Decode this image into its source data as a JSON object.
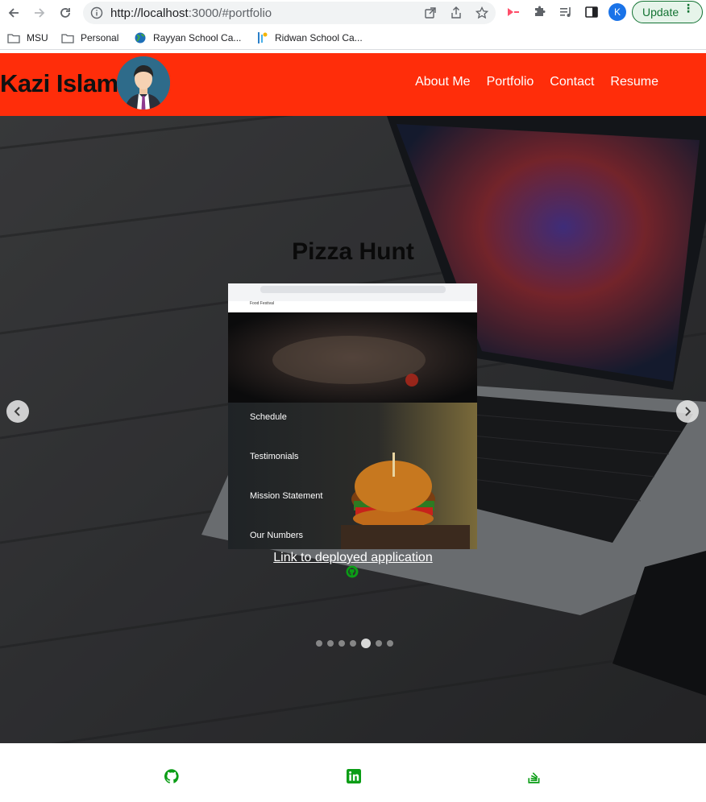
{
  "browser": {
    "url_host": "http://localhost",
    "url_rest": ":3000/#portfolio",
    "profile_initial": "K",
    "update_label": "Update",
    "update_more": "⋮"
  },
  "bookmarks": [
    {
      "label": "MSU",
      "icon": "folder-icon"
    },
    {
      "label": "Personal",
      "icon": "folder-icon"
    },
    {
      "label": "Rayyan School Ca...",
      "icon": "globe-icon"
    },
    {
      "label": "Ridwan School Ca...",
      "icon": "site-favicon-icon"
    }
  ],
  "header": {
    "brand": "Kazi Islam",
    "nav": [
      "About Me",
      "Portfolio",
      "Contact",
      "Resume"
    ],
    "brand_color": "#ff2d0a"
  },
  "carousel": {
    "slide_title": "Pizza Hunt",
    "screenshot_sections": [
      "Schedule",
      "Testimonials",
      "Mission Statement",
      "Our Numbers"
    ],
    "screenshot_brand": "Food Festival",
    "link_text": "Link to deployed application",
    "slide_count": 7,
    "active_slide": 5
  },
  "footer": {
    "icons": [
      "github-icon",
      "linkedin-icon",
      "stackoverflow-icon"
    ],
    "icon_color": "#0b9d16"
  }
}
